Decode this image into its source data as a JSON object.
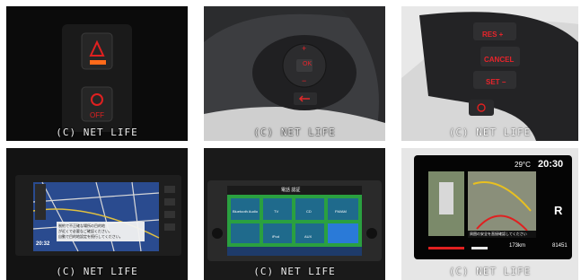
{
  "watermark": "(C) NET LIFE",
  "panel2": {
    "plus_icon": "+",
    "minus_icon": "−",
    "ok_label": "OK"
  },
  "panel3": {
    "res_label": "RES +",
    "cancel_label": "CANCEL",
    "set_label": "SET −"
  },
  "panel4": {
    "time": "20:32",
    "notice_lines": [
      "制約で不正確な場所の目的地",
      "が近くで必要なご確認ください。",
      "自動で目的地設定を続行してください。"
    ]
  },
  "panel5": {
    "title": "電話 認証",
    "tiles": [
      "Bluetooth Audio",
      "TV",
      "CD",
      "FM/AM",
      "",
      "iPod",
      "AUX",
      ""
    ]
  },
  "panel6": {
    "temperature": "29°C",
    "clock": "20:30",
    "gear": "R",
    "warning": "周囲の安全を直接確認してください",
    "distance": "173km",
    "odometer": "81451"
  },
  "colors": {
    "accent_red": "#e8242b",
    "screen_blue": "#2a5ab4",
    "tile_green": "#2ea84a"
  }
}
